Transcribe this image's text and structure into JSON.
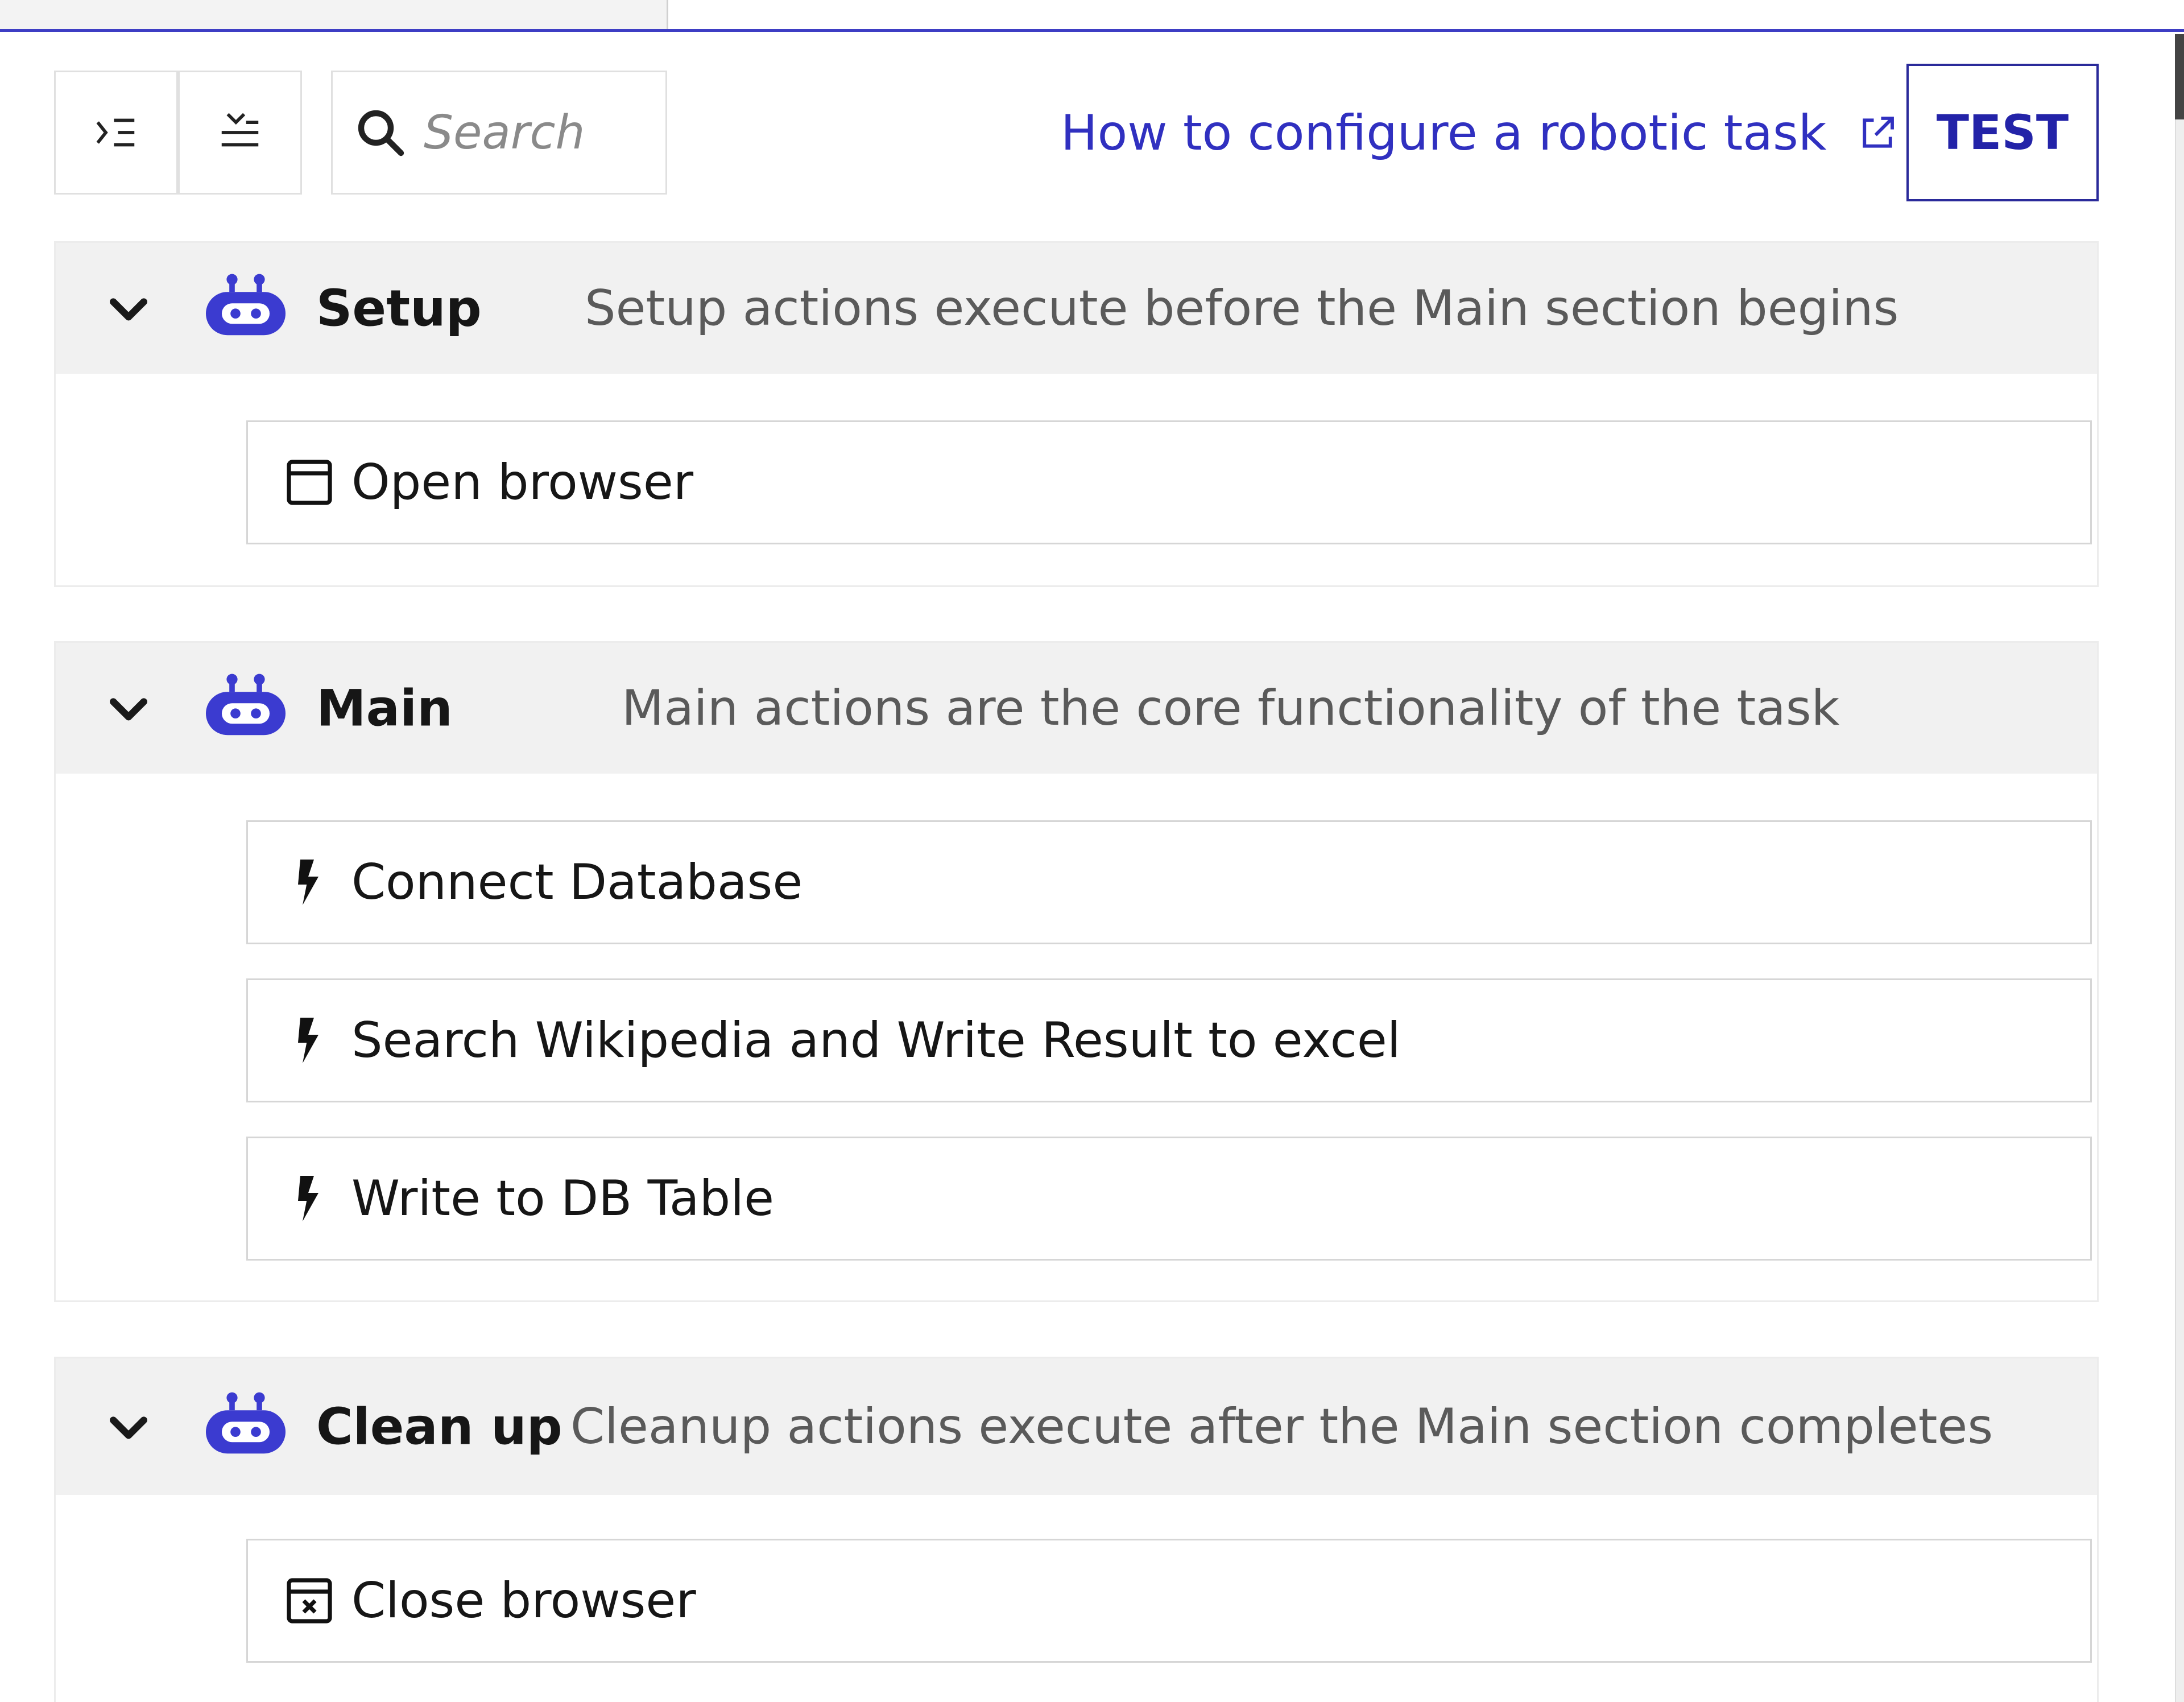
{
  "toolbar": {
    "search_placeholder": "Search",
    "help_link_label": "How to configure a robotic task",
    "test_button_label": "TEST"
  },
  "sections": [
    {
      "title": "Setup",
      "description": "Setup actions execute before the Main section begins",
      "actions": [
        {
          "label": "Open browser",
          "icon": "browser-window-icon"
        }
      ]
    },
    {
      "title": "Main",
      "description": "Main actions are the core functionality of the task",
      "actions": [
        {
          "label": "Connect Database",
          "icon": "lightning-icon"
        },
        {
          "label": "Search Wikipedia and Write Result to excel",
          "icon": "lightning-icon"
        },
        {
          "label": "Write to DB Table",
          "icon": "lightning-icon"
        }
      ]
    },
    {
      "title": "Clean up",
      "description": "Cleanup actions execute after the Main section completes",
      "actions": [
        {
          "label": "Close browser",
          "icon": "close-browser-icon"
        }
      ]
    }
  ],
  "colors": {
    "accent": "#3030c0",
    "robot": "#3b3bd0",
    "header_bg": "#f1f1f1"
  }
}
